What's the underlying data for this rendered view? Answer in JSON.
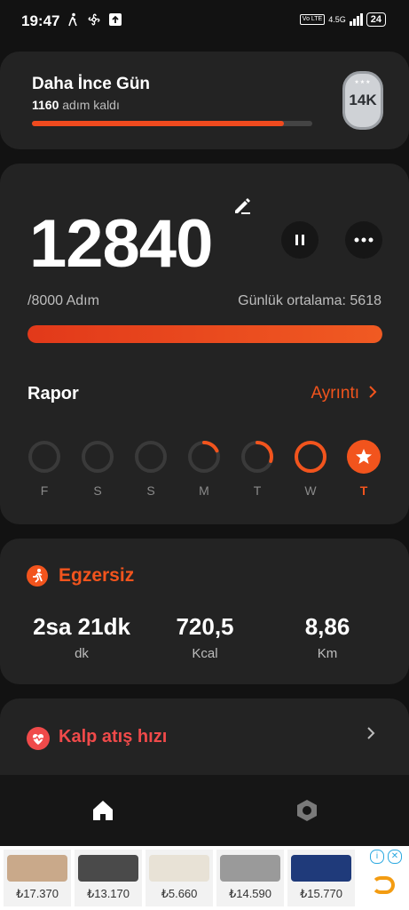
{
  "status": {
    "time": "19:47",
    "network": "4.5G",
    "volte": "Vo LTE",
    "battery": "24"
  },
  "goal": {
    "title": "Daha İnce Gün",
    "remaining_value": "1160",
    "remaining_text": "adım kaldı",
    "progress": 0.9,
    "badge": "14K"
  },
  "main": {
    "steps": "12840",
    "goal_label": "/8000 Adım",
    "average_label": "Günlük ortalama: 5618",
    "progress": 1.0,
    "report_title": "Rapor",
    "detail_link": "Ayrıntı",
    "days": [
      {
        "label": "F",
        "progress": 0.0
      },
      {
        "label": "S",
        "progress": 0.0
      },
      {
        "label": "S",
        "progress": 0.0
      },
      {
        "label": "M",
        "progress": 0.18
      },
      {
        "label": "T",
        "progress": 0.3
      },
      {
        "label": "W",
        "progress": 1.0
      },
      {
        "label": "T",
        "progress": 1.0,
        "today": true
      }
    ]
  },
  "exercise": {
    "title": "Egzersiz",
    "stats": [
      {
        "value": "2sa 21dk",
        "unit": "dk"
      },
      {
        "value": "720,5",
        "unit": "Kcal"
      },
      {
        "value": "8,86",
        "unit": "Km"
      }
    ]
  },
  "heart": {
    "title": "Kalp atış hızı"
  },
  "ad": {
    "prices": [
      "₺17.370",
      "₺13.170",
      "₺5.660",
      "₺14.590",
      "₺15.770"
    ],
    "colors": [
      "#c9a98a",
      "#4a4a4a",
      "#e8e2d6",
      "#9a9a9a",
      "#1f3a7a"
    ]
  },
  "colors": {
    "accent": "#f2541d",
    "heart": "#f04a4a"
  }
}
